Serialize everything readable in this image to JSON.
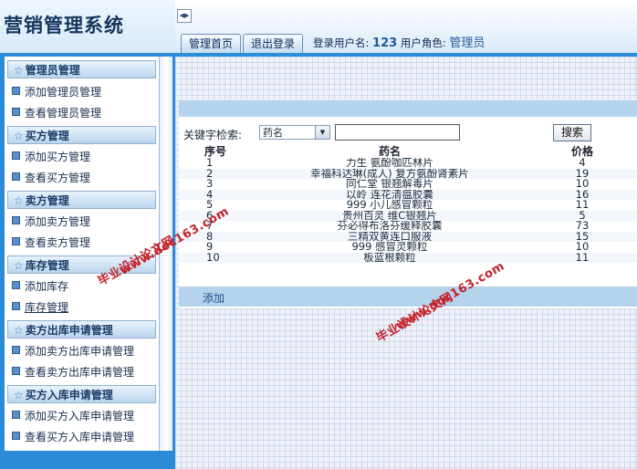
{
  "app": {
    "title": "营销管理系统"
  },
  "header": {
    "toggle_icon": "◀▶",
    "tabs": [
      {
        "label": "管理首页"
      },
      {
        "label": "退出登录"
      }
    ],
    "user_label": "登录用户名:",
    "user_name": "123",
    "role_label": "用户角色:",
    "role_name": "管理员"
  },
  "sidebar": {
    "groups": [
      {
        "title": "管理员管理",
        "items": [
          {
            "label": "添加管理员管理"
          },
          {
            "label": "查看管理员管理"
          }
        ]
      },
      {
        "title": "买方管理",
        "items": [
          {
            "label": "添加买方管理"
          },
          {
            "label": "查看买方管理"
          }
        ]
      },
      {
        "title": "卖方管理",
        "items": [
          {
            "label": "添加卖方管理"
          },
          {
            "label": "查看卖方管理"
          }
        ]
      },
      {
        "title": "库存管理",
        "items": [
          {
            "label": "添加库存"
          },
          {
            "label": "库存管理"
          }
        ]
      },
      {
        "title": "卖方出库申请管理",
        "items": [
          {
            "label": "添加卖方出库申请管理"
          },
          {
            "label": "查看卖方出库申请管理"
          }
        ]
      },
      {
        "title": "买方入库申请管理",
        "items": [
          {
            "label": "添加买方入库申请管理"
          },
          {
            "label": "查看买方入库申请管理"
          }
        ]
      }
    ]
  },
  "search": {
    "label": "关键字检索:",
    "selected_field": "药名",
    "input_value": "",
    "button_label": "搜索"
  },
  "table": {
    "headers": [
      "序号",
      "药名",
      "价格"
    ],
    "rows": [
      {
        "id": "1",
        "name": "力生 氨酚咖匹林片",
        "price": "4"
      },
      {
        "id": "2",
        "name": "幸福科达琳(成人) 复方氨酚肾素片",
        "price": "19"
      },
      {
        "id": "3",
        "name": "同仁堂 银翘解毒片",
        "price": "10"
      },
      {
        "id": "4",
        "name": "以岭 连花清瘟胶囊",
        "price": "16"
      },
      {
        "id": "5",
        "name": "999 小儿感冒颗粒",
        "price": "11"
      },
      {
        "id": "6",
        "name": "贵州百灵 维C银翘片",
        "price": "5"
      },
      {
        "id": "7",
        "name": "芬必得布洛芬缓释胶囊",
        "price": "73"
      },
      {
        "id": "8",
        "name": "三精双黄连口服液",
        "price": "15"
      },
      {
        "id": "9",
        "name": "999 感冒灵颗粒",
        "price": "10"
      },
      {
        "id": "10",
        "name": "板蓝根颗粒",
        "price": "11"
      }
    ],
    "add_label": "添加"
  },
  "watermarks": {
    "line1": "毕业设计论文网",
    "line2": "www.doc163.com"
  },
  "colors": {
    "sidebar_blue": "#2c8bd6",
    "band_blue": "#b6d3ec",
    "watermark_red": "#c3222a"
  }
}
